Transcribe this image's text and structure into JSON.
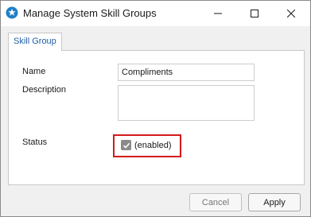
{
  "window": {
    "title": "Manage System Skill Groups",
    "controls": {
      "minimize_icon": "minimize-icon",
      "maximize_icon": "maximize-icon",
      "close_icon": "close-icon"
    }
  },
  "tabs": [
    {
      "label": "Skill Group",
      "selected": true
    }
  ],
  "form": {
    "name_label": "Name",
    "name_value": "Compliments",
    "description_label": "Description",
    "description_value": "",
    "status_label": "Status",
    "status_checked": true,
    "status_text": "(enabled)"
  },
  "buttons": {
    "cancel": "Cancel",
    "apply": "Apply"
  },
  "colors": {
    "tab_text": "#1f5fa8",
    "highlight_border": "#d31a1a",
    "app_icon": "#1f7fc4"
  }
}
